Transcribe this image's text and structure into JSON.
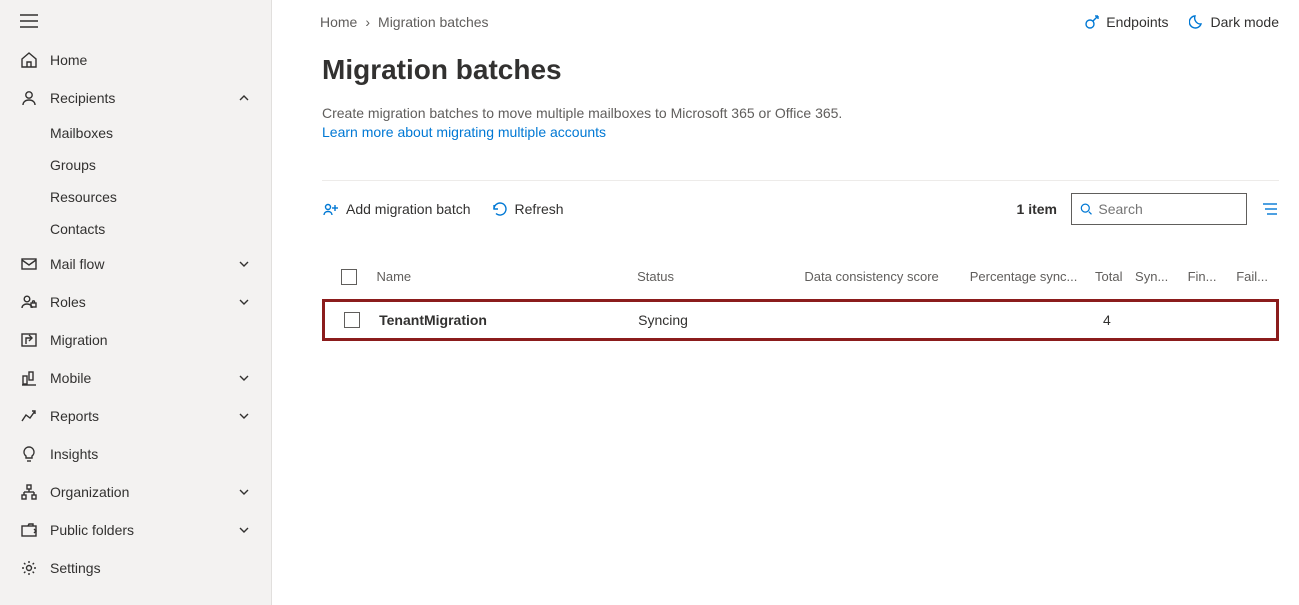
{
  "sidebar": {
    "items": [
      {
        "label": "Home",
        "icon": "home"
      },
      {
        "label": "Recipients",
        "icon": "person",
        "expanded": true,
        "children": [
          "Mailboxes",
          "Groups",
          "Resources",
          "Contacts"
        ]
      },
      {
        "label": "Mail flow",
        "icon": "mail",
        "expandable": true
      },
      {
        "label": "Roles",
        "icon": "roles",
        "expandable": true
      },
      {
        "label": "Migration",
        "icon": "migration"
      },
      {
        "label": "Mobile",
        "icon": "mobile",
        "expandable": true
      },
      {
        "label": "Reports",
        "icon": "reports",
        "expandable": true
      },
      {
        "label": "Insights",
        "icon": "bulb"
      },
      {
        "label": "Organization",
        "icon": "org",
        "expandable": true
      },
      {
        "label": "Public folders",
        "icon": "folder",
        "expandable": true
      },
      {
        "label": "Settings",
        "icon": "gear"
      }
    ]
  },
  "breadcrumb": {
    "home": "Home",
    "current": "Migration batches"
  },
  "top_actions": {
    "endpoints": "Endpoints",
    "dark_mode": "Dark mode"
  },
  "page": {
    "title": "Migration batches",
    "description": "Create migration batches to move multiple mailboxes to Microsoft 365 or Office 365.",
    "learn_more": "Learn more about migrating multiple accounts"
  },
  "toolbar": {
    "add": "Add migration batch",
    "refresh": "Refresh",
    "item_count": "1 item",
    "search_placeholder": "Search"
  },
  "table": {
    "columns": {
      "name": "Name",
      "status": "Status",
      "dcs": "Data consistency score",
      "psync": "Percentage sync...",
      "total": "Total",
      "syn": "Syn...",
      "fin": "Fin...",
      "fail": "Fail..."
    },
    "rows": [
      {
        "name": "TenantMigration",
        "status": "Syncing",
        "dcs": "",
        "psync": "",
        "total": "4",
        "syn": "",
        "fin": "",
        "fail": ""
      }
    ]
  }
}
